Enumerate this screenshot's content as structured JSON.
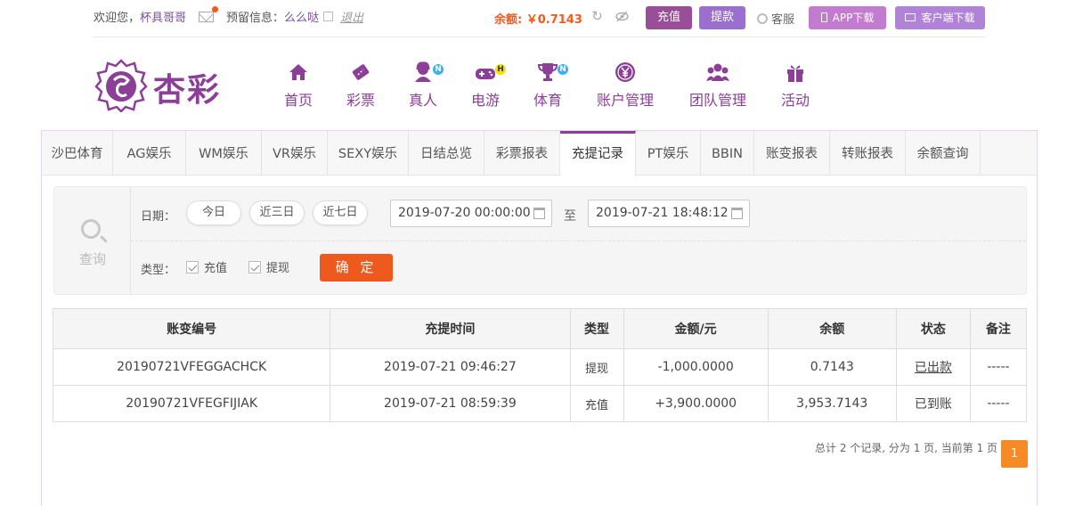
{
  "topbar": {
    "welcome": "欢迎您，",
    "username": "杯具哥哥",
    "message_label": "预留信息：",
    "message_value": "么么哒",
    "logout": "退出",
    "balance_label": "余额:",
    "balance_value": "￥0.7143",
    "deposit_label": "充值",
    "withdraw_label": "提款",
    "service_label": "客服",
    "app_download": "APP下载",
    "client_download": "客户端下载"
  },
  "logo": {
    "text": "杏彩"
  },
  "nav": [
    {
      "label": "首页",
      "icon": "home-icon"
    },
    {
      "label": "彩票",
      "icon": "ticket-icon"
    },
    {
      "label": "真人",
      "icon": "dealer-icon",
      "badge": "N"
    },
    {
      "label": "电游",
      "icon": "gamepad-icon",
      "badge": "H"
    },
    {
      "label": "体育",
      "icon": "trophy-icon",
      "badge": "N"
    },
    {
      "label": "账户管理",
      "icon": "yen-coin-icon"
    },
    {
      "label": "团队管理",
      "icon": "team-icon"
    },
    {
      "label": "活动",
      "icon": "gift-icon"
    }
  ],
  "tabs": [
    {
      "label": "沙巴体育"
    },
    {
      "label": "AG娱乐"
    },
    {
      "label": "WM娱乐"
    },
    {
      "label": "VR娱乐"
    },
    {
      "label": "SEXY娱乐"
    },
    {
      "label": "日结总览"
    },
    {
      "label": "彩票报表"
    },
    {
      "label": "充提记录",
      "active": true
    },
    {
      "label": "PT娱乐"
    },
    {
      "label": "BBIN"
    },
    {
      "label": "账变报表"
    },
    {
      "label": "转账报表"
    },
    {
      "label": "余额查询"
    }
  ],
  "filter": {
    "query_label": "查询",
    "date_label": "日期：",
    "quick_ranges": [
      "今日",
      "近三日",
      "近七日"
    ],
    "date_from": "2019-07-20 00:00:00",
    "date_to": "2019-07-21 18:48:12",
    "to_label": "至",
    "type_label": "类型：",
    "types": [
      "充值",
      "提现"
    ],
    "confirm_label": "确 定"
  },
  "table": {
    "headers": [
      "账变编号",
      "充提时间",
      "类型",
      "金额/元",
      "余额",
      "状态",
      "备注"
    ],
    "rows": [
      [
        "20190721VFEGGACHCK",
        "2019-07-21 09:46:27",
        "提现",
        "-1,000.0000",
        "0.7143",
        "已出款",
        "-----"
      ],
      [
        "20190721VFEGFIJIAK",
        "2019-07-21 08:59:39",
        "充值",
        "+3,900.0000",
        "3,953.7143",
        "已到账",
        "-----"
      ]
    ]
  },
  "pager": {
    "summary": "总计 2 个记录, 分为 1 页, 当前第 1 页",
    "current": "1"
  },
  "colors": {
    "brand_purple": "#8b3f97",
    "accent_orange": "#ee5a1e",
    "negative_green": "#2f8a2f",
    "positive_red": "#d42f2f"
  }
}
